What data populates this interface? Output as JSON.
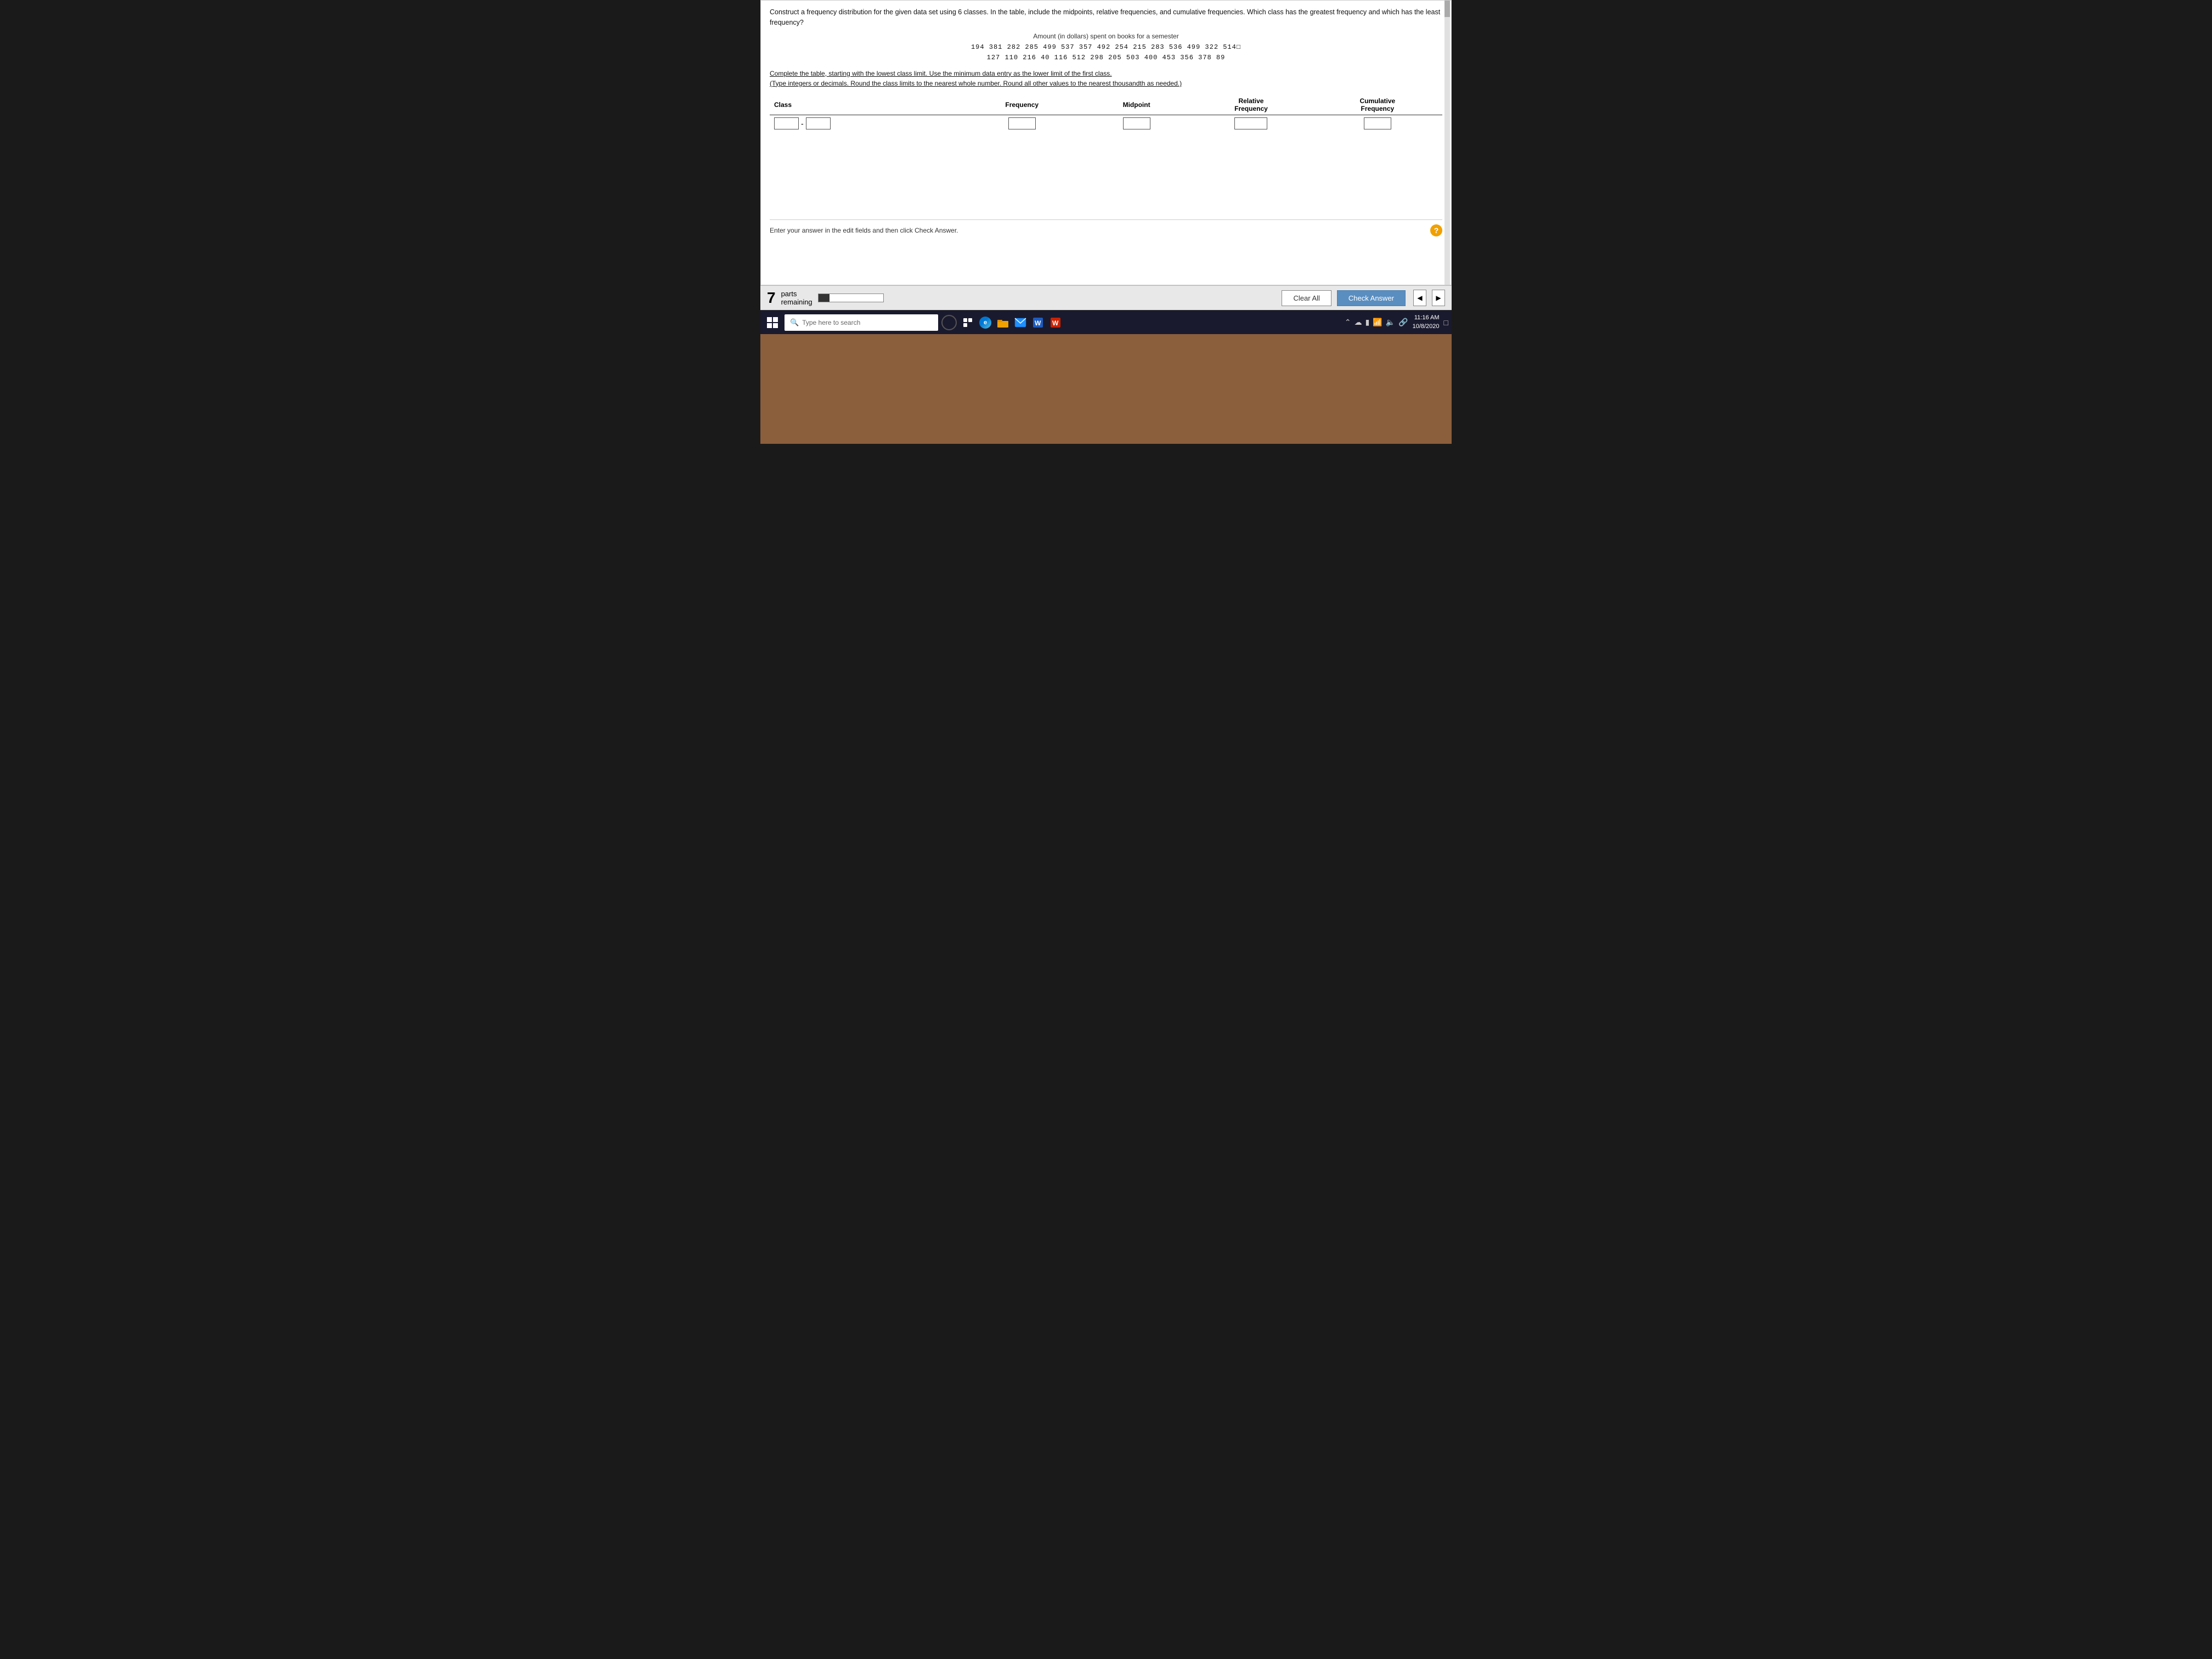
{
  "question": {
    "main_text": "Construct a frequency distribution for the given data set using 6 classes. In the table, include the midpoints, relative frequencies, and cumulative frequencies. Which class has the greatest frequency and which has the least frequency?",
    "data_title": "Amount (in dollars) spent on books for a semester",
    "data_row1": "194  381  282  285  499  537  357  492  254  215  283  536  499  322  514□",
    "data_row2": "127  110  216   40  116  512  298  205  503  400  453  356  378   89",
    "instructions": "Complete the table, starting with the lowest class limit. Use the minimum data entry as the lower limit of the first class.",
    "instructions2": "(Type integers or decimals. Round the class limits to the nearest whole number. Round all other values to the nearest thousandth as needed.)",
    "col_class": "Class",
    "col_frequency": "Frequency",
    "col_midpoint": "Midpoint",
    "col_relative_freq": "Relative\nFrequency",
    "col_cumulative_freq": "Cumulative\nFrequency"
  },
  "footer": {
    "text": "Enter your answer in the edit fields and then click Check Answer.",
    "help_label": "?"
  },
  "parts_bar": {
    "number": "7",
    "label_line1": "parts",
    "label_line2": "remaining",
    "clear_all": "Clear All",
    "check_answer": "Check Answer"
  },
  "taskbar": {
    "search_placeholder": "Type here to search",
    "time": "11:16 AM",
    "date": "10/8/2020"
  }
}
